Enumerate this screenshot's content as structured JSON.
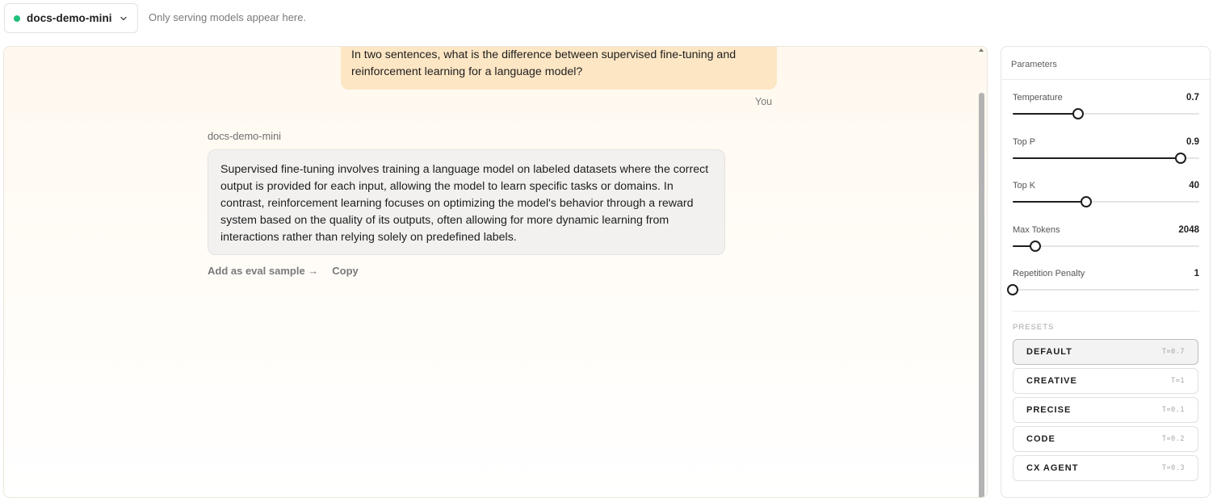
{
  "header": {
    "model_name": "docs-demo-mini",
    "hint": "Only serving models appear here."
  },
  "chat": {
    "user_message": "In two sentences, what is the difference between supervised fine-tuning and reinforcement learning for a language model?",
    "user_label": "You",
    "assistant_label": "docs-demo-mini",
    "assistant_message": "Supervised fine-tuning involves training a language model on labeled datasets where the correct output is provided for each input, allowing the model to learn specific tasks or domains. In contrast, reinforcement learning focuses on optimizing the model's behavior through a reward system based on the quality of its outputs, often allowing for more dynamic learning from interactions rather than relying solely on predefined labels.",
    "actions": {
      "add_eval": "Add as eval sample →",
      "copy": "Copy"
    }
  },
  "parameters": {
    "title": "Parameters",
    "items": [
      {
        "label": "Temperature",
        "value": "0.7",
        "fraction": 0.35
      },
      {
        "label": "Top P",
        "value": "0.9",
        "fraction": 0.9
      },
      {
        "label": "Top K",
        "value": "40",
        "fraction": 0.395
      },
      {
        "label": "Max Tokens",
        "value": "2048",
        "fraction": 0.12
      },
      {
        "label": "Repetition Penalty",
        "value": "1",
        "fraction": 0.0
      }
    ],
    "presets_label": "PRESETS",
    "presets": [
      {
        "name": "DEFAULT",
        "temp": "T=0.7",
        "active": true
      },
      {
        "name": "CREATIVE",
        "temp": "T=1",
        "active": false
      },
      {
        "name": "PRECISE",
        "temp": "T=0.1",
        "active": false
      },
      {
        "name": "CODE",
        "temp": "T=0.2",
        "active": false
      },
      {
        "name": "CX AGENT",
        "temp": "T=0.3",
        "active": false
      }
    ]
  },
  "colors": {
    "status_dot": "#1fbf7a",
    "user_bubble": "#fde6c4",
    "assistant_bubble": "#f2f1f0"
  }
}
